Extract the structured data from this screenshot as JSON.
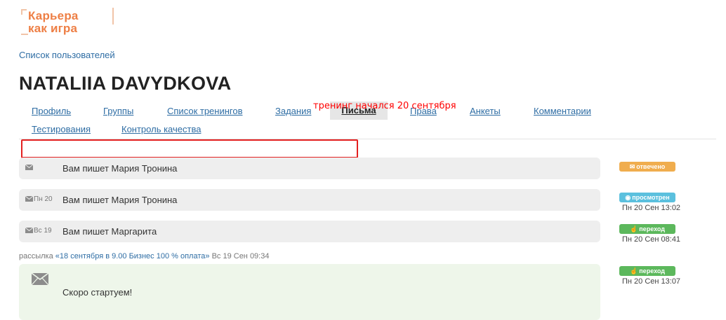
{
  "logo": {
    "line1": "Карьера",
    "line2": "как игра"
  },
  "breadcrumb": {
    "users_list": "Список пользователей"
  },
  "user": {
    "name": "NATALIIA DAVYDKOVA"
  },
  "tabs": [
    {
      "label": "Профиль"
    },
    {
      "label": "Группы"
    },
    {
      "label": "Список тренингов"
    },
    {
      "label": "Задания"
    },
    {
      "label": "Письма",
      "active": true
    },
    {
      "label": "Права"
    },
    {
      "label": "Анкеты"
    },
    {
      "label": "Комментарии"
    },
    {
      "label": "Тестирования"
    },
    {
      "label": "Контроль качества"
    }
  ],
  "overlay_note": "тренинг начался 20 сентября",
  "messages": [
    {
      "date": "",
      "subject": "Вам пишет Мария Тронина",
      "status": "отвечено",
      "status_color": "#f0ad4e",
      "status_icon": "envelope-icon",
      "timestamp": ""
    },
    {
      "date": "Пн 20",
      "subject": "Вам пишет Мария Тронина",
      "status": "просмотрен",
      "status_color": "#5bc0de",
      "status_icon": "eye-icon",
      "timestamp": "Пн 20 Сен 13:02"
    },
    {
      "date": "Вс 19",
      "subject": "Вам пишет Маргарита",
      "status": "переход",
      "status_color": "#5cb85c",
      "status_icon": "pointer-icon",
      "timestamp": "Пн 20 Сен 08:41"
    }
  ],
  "mailing": {
    "prefix": "рассылка",
    "link": "«18 сентября в 9.00 Бизнес 100 % оплата»",
    "sent": "Вс 19 Сен 09:34",
    "body": "Скоро стартуем!",
    "status": "переход",
    "status_color": "#5cb85c",
    "status_icon": "pointer-icon",
    "timestamp": "Пн 20 Сен 13:07"
  }
}
